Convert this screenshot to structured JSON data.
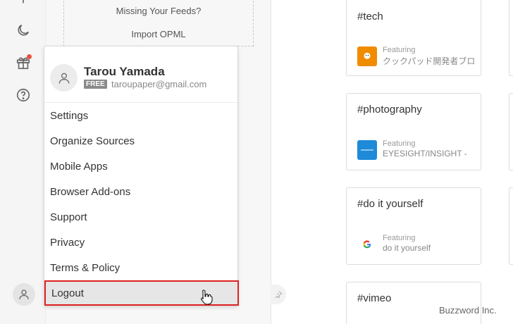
{
  "rail": {
    "icons": [
      "night-mode-icon",
      "gift-icon",
      "help-icon",
      "user-icon"
    ],
    "gift_dot_color": "#e8523f"
  },
  "sources": {
    "missing_feeds": "Missing Your Feeds?",
    "import_opml": "Import OPML"
  },
  "menu": {
    "user_name": "Tarou Yamada",
    "plan": "FREE",
    "email": "taroupaper@gmail.com",
    "items": [
      "Settings",
      "Organize Sources",
      "Mobile Apps",
      "Browser Add-ons",
      "Support",
      "Privacy",
      "Terms & Policy",
      "Logout"
    ],
    "highlight_color": "#e02020"
  },
  "cards": [
    {
      "tag": "#tech",
      "featuring_label": "Featuring",
      "featuring_name": "クックパッド開発者ブロ",
      "logo": "cookpad-logo"
    },
    {
      "tag": "#photography",
      "featuring_label": "Featuring",
      "featuring_name": "EYESIGHT/INSIGHT -",
      "logo": "eyesight-logo"
    },
    {
      "tag": "#do it yourself",
      "featuring_label": "Featuring",
      "featuring_name": "do it yourself",
      "logo": "google-logo"
    },
    {
      "tag": "#vimeo"
    }
  ],
  "watermark": "Buzzword Inc."
}
